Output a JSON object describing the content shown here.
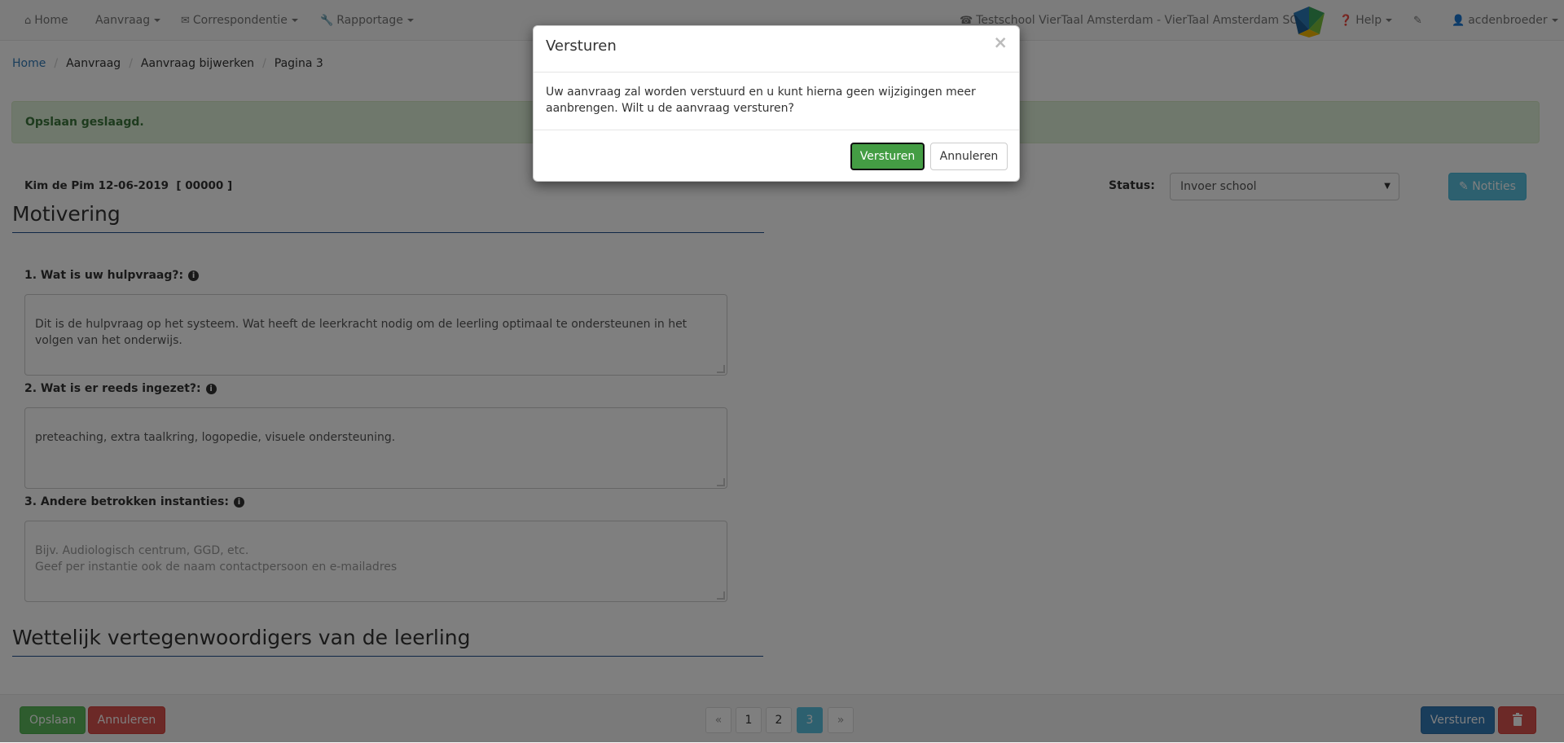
{
  "nav": {
    "home": "Home",
    "aanvraag": "Aanvraag",
    "correspondentie": "Correspondentie",
    "rapportage": "Rapportage",
    "school": "Testschool VierTaal Amsterdam - VierTaal Amsterdam SO",
    "help": "Help",
    "user": "acdenbroeder"
  },
  "breadcrumb": {
    "home": "Home",
    "aanvraag": "Aanvraag",
    "bijwerken": "Aanvraag bijwerken",
    "pagina": "Pagina 3"
  },
  "alert": {
    "message": "Opslaan geslaagd."
  },
  "student": {
    "info": "Kim de Pim 12-06-2019  [ 00000 ]"
  },
  "status": {
    "label": "Status:",
    "value": "Invoer school"
  },
  "notes_button": "Notities",
  "sections": {
    "motivering": "Motivering",
    "vertegenwoordigers": "Wettelijk vertegenwoordigers van de leerling"
  },
  "questions": [
    {
      "label": "1. Wat is uw hulpvraag?:",
      "value": "Dit is de hulpvraag op het systeem. Wat heeft de leerkracht nodig om de leerling optimaal te ondersteunen in het volgen van het onderwijs."
    },
    {
      "label": "2. Wat is er reeds ingezet?:",
      "value": "preteaching, extra taalkring, logopedie, visuele ondersteuning."
    },
    {
      "label": "3. Andere betrokken instanties:",
      "placeholder": "Bijv. Audiologisch centrum, GGD, etc.\nGeef per instantie ook de naam contactpersoon en e-mailadres"
    }
  ],
  "footer": {
    "save": "Opslaan",
    "cancel": "Annuleren",
    "send": "Versturen",
    "pages": [
      "«",
      "1",
      "2",
      "3",
      "»"
    ],
    "active_page": "3"
  },
  "modal": {
    "title": "Versturen",
    "close": "×",
    "body": "Uw aanvraag zal worden verstuurd en u kunt hierna geen wijzigingen meer aanbrengen. Wilt u de aanvraag versturen?",
    "confirm": "Versturen",
    "cancel": "Annuleren"
  },
  "colors": {
    "success": "#5cb85c",
    "danger": "#d9534f",
    "primary": "#337ab7",
    "info": "#5bc0de",
    "section_rule": "#1f4e8c"
  }
}
